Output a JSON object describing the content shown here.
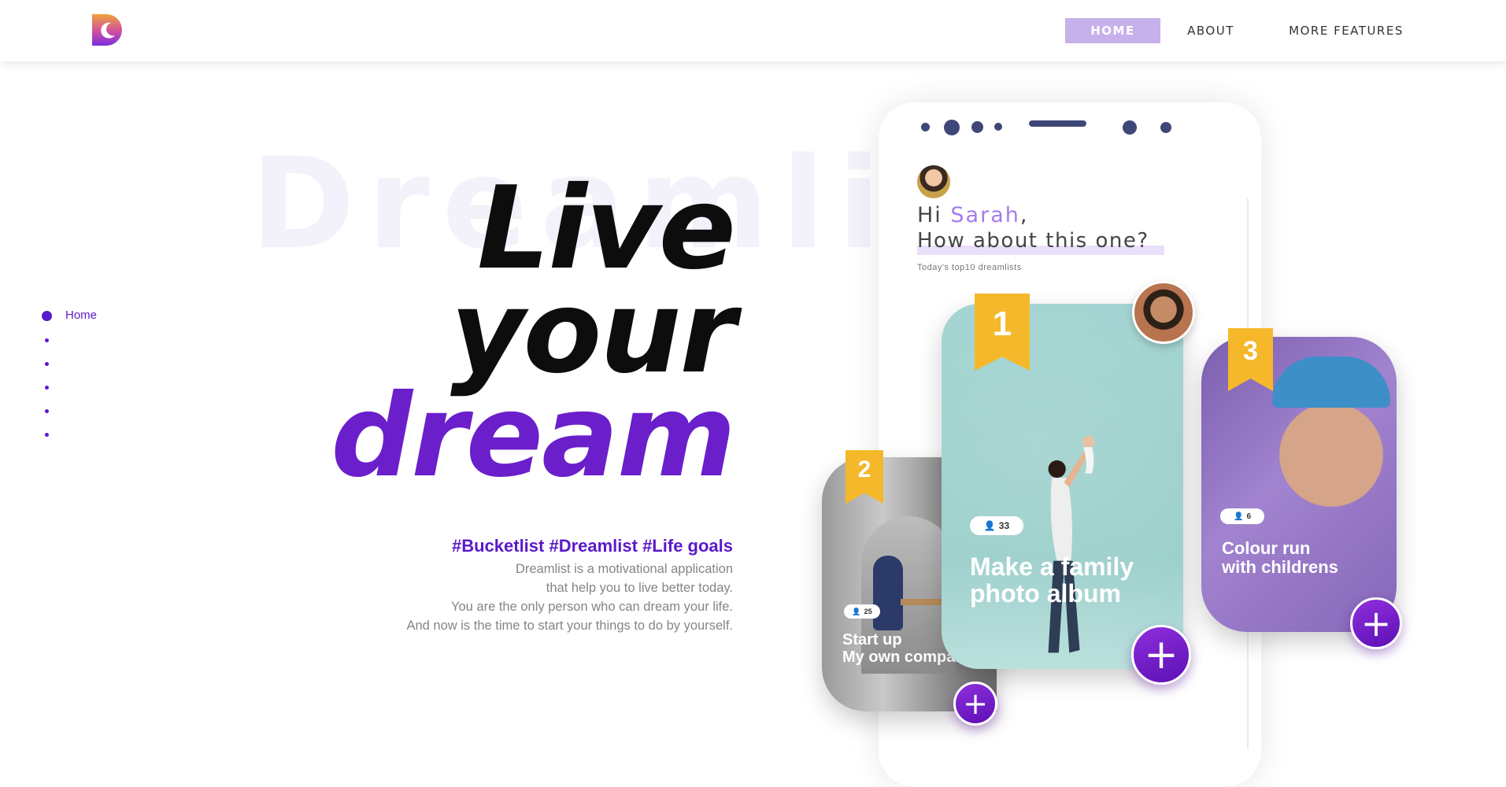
{
  "brand": {
    "accent": "#6a1fcb",
    "dark_purple": "#5a19c9",
    "logo_icon": "moon-logo-icon"
  },
  "nav": {
    "home": "HOME",
    "about": "ABOUT",
    "more": "MORE FEATURES"
  },
  "sidenav": {
    "active_label": "Home"
  },
  "hero": {
    "watermark": "Dreamlist",
    "line1": "Live",
    "line2": "your",
    "line3": "dream",
    "tags": "#Bucketlist #Dreamlist #Life goals",
    "desc": [
      "Dreamlist is a motivational application",
      "that help you to live better today.",
      "You are the only person who can dream your life.",
      "And now is the time to start your things to do by yourself."
    ]
  },
  "phone": {
    "greeting_hi": "Hi",
    "greeting_name": "Sarah",
    "greeting_comma": ",",
    "greeting_question": "How about this one?",
    "subtitle": "Today's top10 dreamlists"
  },
  "cards": [
    {
      "rank": "1",
      "count": "33",
      "title_line1": "Make a family",
      "title_line2": "photo album"
    },
    {
      "rank": "2",
      "count": "25",
      "title_line1": "Start up",
      "title_line2": "My own company"
    },
    {
      "rank": "3",
      "count": "6",
      "title_line1": "Colour run",
      "title_line2": "with childrens"
    }
  ],
  "icons": {
    "plus": "+",
    "person": "person-icon"
  }
}
